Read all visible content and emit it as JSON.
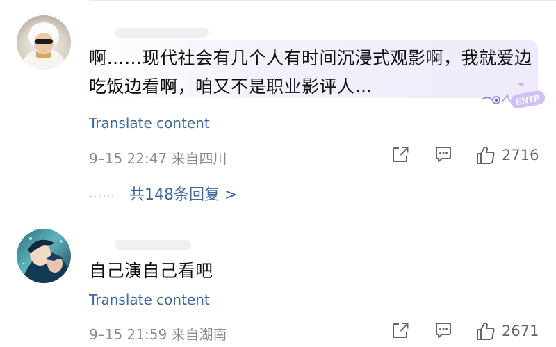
{
  "comments": [
    {
      "text": "啊……现代社会有几个人有时间沉浸式观影啊，我就爱边吃饭边看啊，咱又不是职业影评人…",
      "translate_label": "Translate content",
      "time": "9–15 22:47",
      "location": "来自四川",
      "likes": "2716",
      "replies_dots": "……",
      "replies_label": "共148条回复 >",
      "badge_text": "ENTP"
    },
    {
      "text": "自己演自己看吧",
      "translate_label": "Translate content",
      "time": "9–15 21:59",
      "location": "来自湖南",
      "likes": "2671"
    }
  ],
  "colors": {
    "link": "#3e6a9b",
    "meta": "#8a8a8a",
    "bubble": "#efeafb"
  },
  "icons": [
    "share-icon",
    "comment-icon",
    "like-icon"
  ]
}
